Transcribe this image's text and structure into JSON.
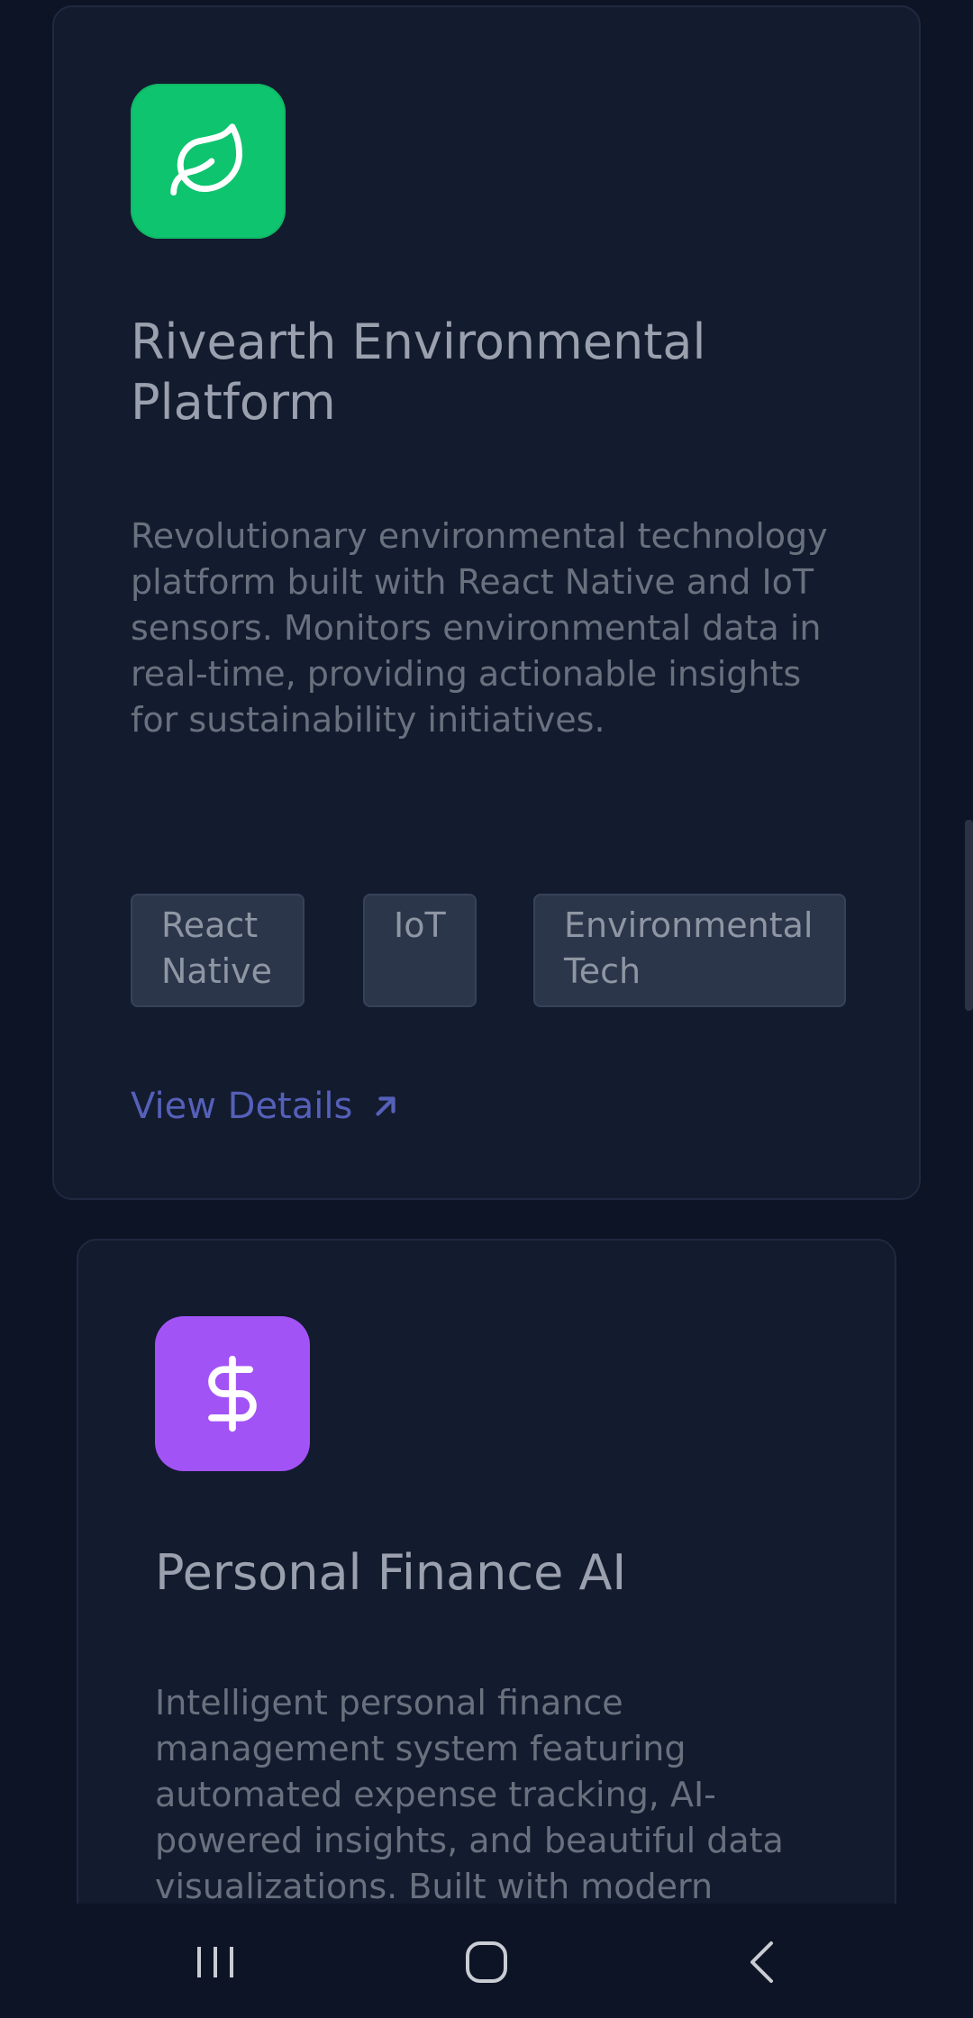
{
  "projects": [
    {
      "icon": "leaf-icon",
      "icon_color": "#0fc46f",
      "title": "Rivearth Environmental Platform",
      "description": "Revolutionary environmental technology platform built with React Native and IoT sensors. Monitors environmental data in real-time, providing actionable insights for sustainability initiatives.",
      "tags": [
        "React Native",
        "IoT",
        "Environmental Tech"
      ],
      "link_label": "View Details"
    },
    {
      "icon": "dollar-icon",
      "icon_color": "#a253f5",
      "title": "Personal Finance AI",
      "description": "Intelligent personal finance management system featuring automated expense tracking, AI-powered insights, and beautiful data visualizations. Built with modern"
    }
  ],
  "navbar": {
    "buttons": [
      "recents-icon",
      "home-icon",
      "back-icon"
    ]
  },
  "colors": {
    "background": "#0d1425",
    "card": "#131b2e",
    "link": "#5560b9"
  }
}
